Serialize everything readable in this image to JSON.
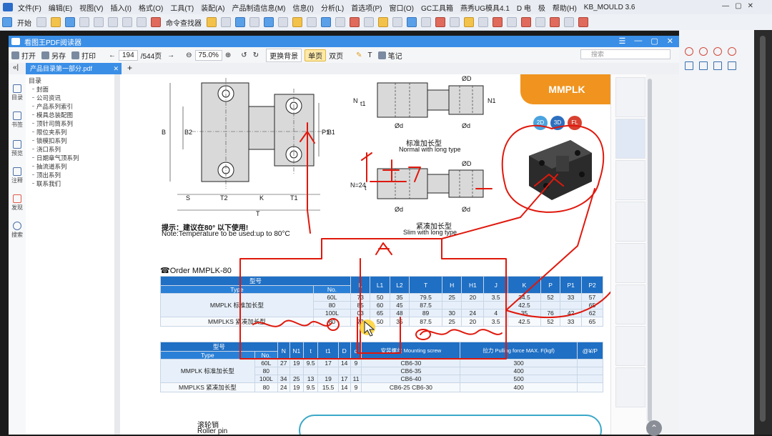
{
  "cad": {
    "menu": [
      "文件(F)",
      "编辑(E)",
      "视图(V)",
      "插入(I)",
      "格式(O)",
      "工具(T)",
      "装配(A)",
      "产品制造信息(M)",
      "信息(I)",
      "分析(L)",
      "首选项(P)",
      "窗口(O)",
      "GC工具箱",
      "燕秀UG模具4.1",
      "D 电",
      "极",
      "帮助(H)",
      "KB_MOULD 3.6"
    ],
    "toolbar_start": "开始",
    "toolbar_cmd_finder": "命令查找器",
    "window_controls": [
      "—",
      "▢",
      "✕"
    ]
  },
  "pdf": {
    "app_title": "看图王PDF阅读器",
    "title_controls": [
      "☰",
      "—",
      "▢",
      "✕"
    ],
    "open": "打开",
    "save_as": "另存",
    "print": "打印",
    "page_current": "194",
    "page_total": "/544页",
    "zoom": "75.0%",
    "change_bg": "更换背景",
    "single_page": "单页",
    "double_page": "双页",
    "note": "笔记",
    "search_placeholder": "搜索",
    "tab_name": "产品目录第一部分.pdf",
    "side_icons": [
      "目录",
      "书签",
      "预览",
      "注释",
      "发现",
      "搜索"
    ],
    "toc_title": "目录",
    "toc_items": [
      "封面",
      "公司资讯",
      "产品系列索引",
      "模具总装配图",
      "顶针司筒系列",
      "限位夹系列",
      "锁模扣系列",
      "浇口系列",
      "日期章气顶系列",
      "抽流道系列",
      "顶出系列",
      "联系我们"
    ]
  },
  "page": {
    "banner": "MMPLK",
    "normal_cn": "标准加长型",
    "normal_en": "Normal with long type",
    "slim_cn": "紧凑加长型",
    "slim_en": "Slim with long type",
    "temp_cn": "提示：建议在80° 以下使用!",
    "temp_en": "Note:Temperature to be used:up to 80°C",
    "order": "☎Order  MMPLK-80",
    "badges": [
      "2D",
      "3D",
      "FL"
    ],
    "roller_cn": "滚轮销",
    "roller_en": "Roller pin",
    "dims_left": [
      "S",
      "T2",
      "K",
      "T1",
      "T",
      "B",
      "B2",
      "P1",
      "B1"
    ],
    "dims_right": [
      "N",
      "t1",
      "N1",
      "ØD",
      "Ød",
      "Ød",
      "N=24",
      "t",
      "ØD",
      "Ød",
      "Ød"
    ],
    "table1": {
      "header_group": "型号",
      "headers": [
        "Type",
        "No.",
        "L",
        "L1",
        "L2",
        "T",
        "H",
        "H1",
        "J",
        "K",
        "P",
        "P1",
        "P2"
      ],
      "rows": [
        [
          "MMPLK 标准加长型",
          "60L",
          "73",
          "50",
          "35",
          "79.5",
          "25",
          "20",
          "3.5",
          "34.5",
          "52",
          "33",
          "57"
        ],
        [
          "",
          "80",
          "85",
          "60",
          "45",
          "87.5",
          "",
          "",
          "",
          "42.5",
          "",
          "",
          "65"
        ],
        [
          "",
          "100L",
          "03",
          "65",
          "48",
          "89",
          "30",
          "24",
          "4",
          "35",
          "76",
          "42",
          "62"
        ],
        [
          "MMPLKS 紧凑加长型",
          "80",
          "73",
          "50",
          "35",
          "87.5",
          "25",
          "20",
          "3.5",
          "42.5",
          "52",
          "33",
          "65"
        ]
      ]
    },
    "table2": {
      "header_group": "型号",
      "headers": [
        "Type",
        "No.",
        "N",
        "N1",
        "t",
        "t1",
        "D",
        "d",
        "安装螺丝 Mounting screw",
        "拉力 Pulling force MAX. F(kgf)",
        "@¥/P"
      ],
      "rows": [
        [
          "MMPLK 标准加长型",
          "60L",
          "27",
          "19",
          "9.5",
          "17",
          "14",
          "9",
          "CB6-30",
          "300",
          ""
        ],
        [
          "",
          "80",
          "",
          "",
          "",
          "",
          "",
          "",
          "CB6-35",
          "400",
          ""
        ],
        [
          "",
          "100L",
          "34",
          "25",
          "13",
          "19",
          "17",
          "11",
          "CB6-40",
          "500",
          ""
        ],
        [
          "MMPLKS 紧凑加长型",
          "80",
          "24",
          "19",
          "9.5",
          "15.5",
          "14",
          "9",
          "CB6-25 CB6-30",
          "400",
          ""
        ]
      ]
    }
  }
}
